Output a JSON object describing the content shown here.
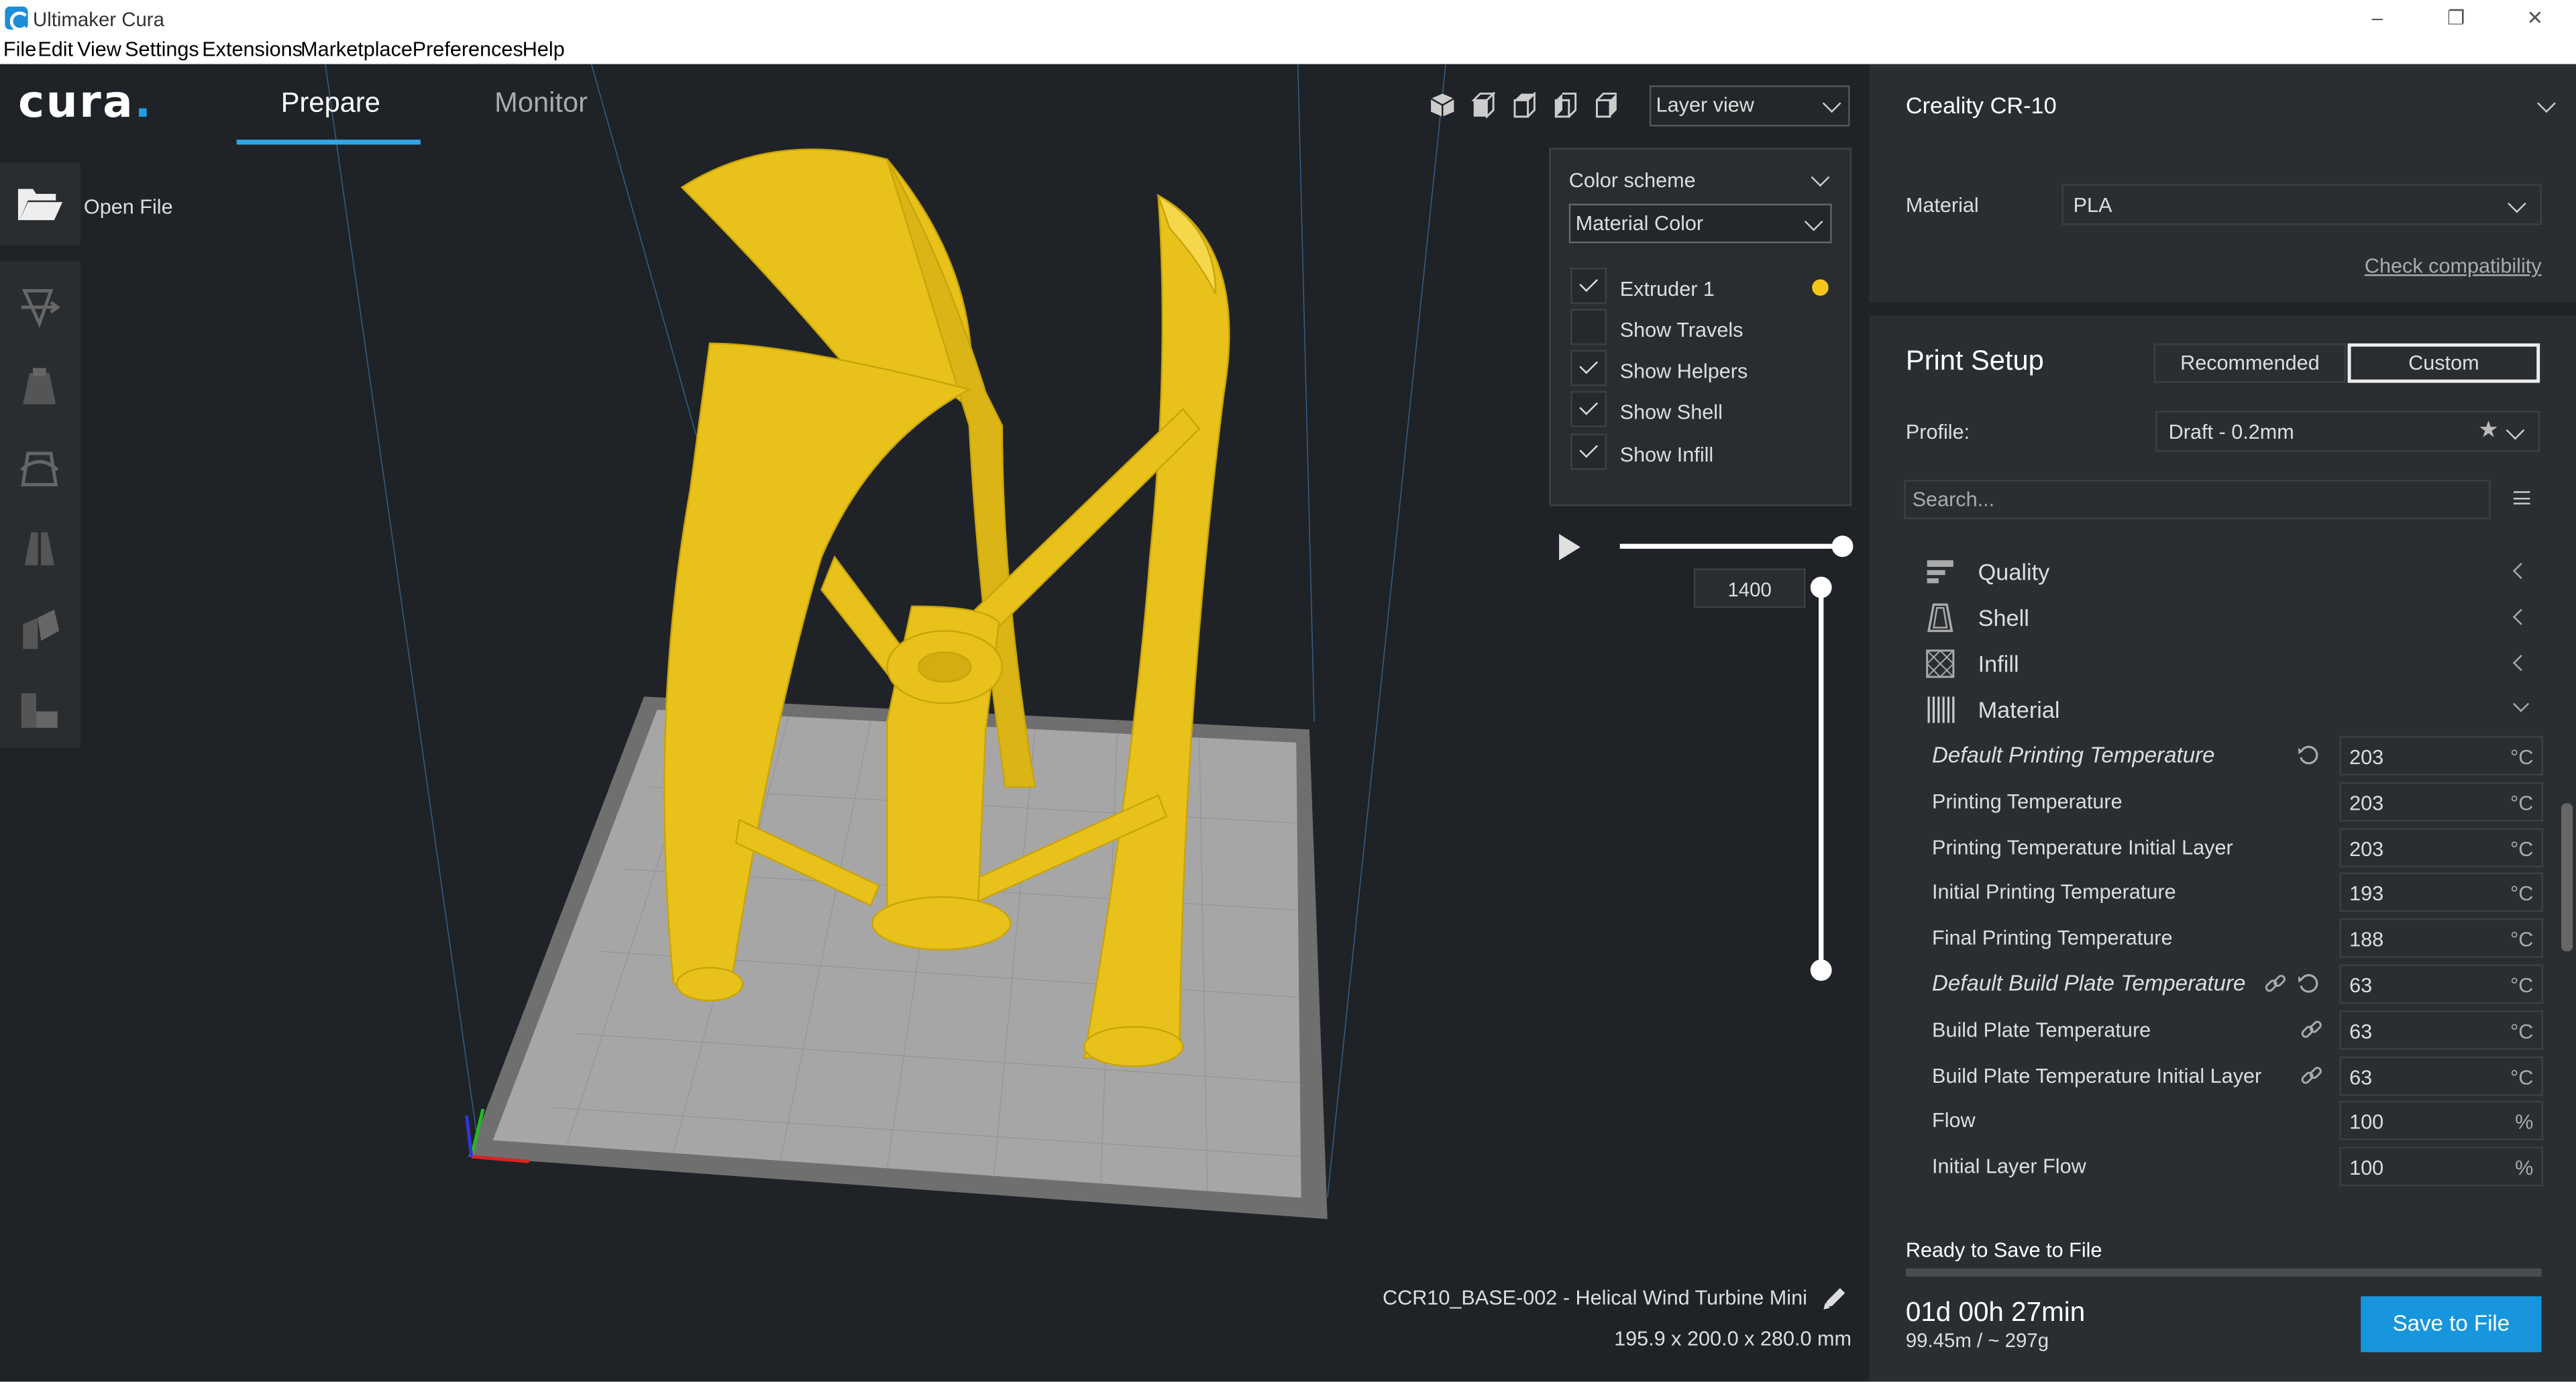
{
  "window": {
    "title": "Ultimaker Cura"
  },
  "menu": [
    "File",
    "Edit",
    "View",
    "Settings",
    "Extensions",
    "Marketplace",
    "Preferences",
    "Help"
  ],
  "header": {
    "logo": "cura",
    "tabs": [
      "Prepare",
      "Monitor"
    ],
    "active_tab": "Prepare",
    "view_mode": "Layer view"
  },
  "toolbar": {
    "open_file": "Open File"
  },
  "layer_panel": {
    "color_scheme_label": "Color scheme",
    "color_scheme_value": "Material Color",
    "options": [
      {
        "label": "Extruder 1",
        "checked": true
      },
      {
        "label": "Show Travels",
        "checked": false
      },
      {
        "label": "Show Helpers",
        "checked": true
      },
      {
        "label": "Show Shell",
        "checked": true
      },
      {
        "label": "Show Infill",
        "checked": true
      }
    ],
    "extruder_color": "#f5c71a",
    "current_layer": "1400"
  },
  "object": {
    "name": "CCR10_BASE-002 - Helical Wind Turbine Mini",
    "dimensions": "195.9 x 200.0 x 280.0 mm"
  },
  "printer": {
    "name": "Creality CR-10",
    "material_label": "Material",
    "material_value": "PLA",
    "check_compat": "Check compatibility"
  },
  "print_setup": {
    "title": "Print Setup",
    "modes": [
      "Recommended",
      "Custom"
    ],
    "active_mode": "Custom",
    "profile_label": "Profile:",
    "profile_value": "Draft - 0.2mm",
    "search_placeholder": "Search...",
    "categories": [
      {
        "label": "Quality",
        "icon": "quality-icon",
        "expanded": false
      },
      {
        "label": "Shell",
        "icon": "shell-icon",
        "expanded": false
      },
      {
        "label": "Infill",
        "icon": "infill-icon",
        "expanded": false
      },
      {
        "label": "Material",
        "icon": "material-icon",
        "expanded": true
      }
    ],
    "settings": [
      {
        "label": "Default Printing Temperature",
        "value": "203",
        "unit": "°C",
        "italic": true,
        "reset": true,
        "link": false
      },
      {
        "label": "Printing Temperature",
        "value": "203",
        "unit": "°C",
        "italic": false,
        "reset": false,
        "link": false
      },
      {
        "label": "Printing Temperature Initial Layer",
        "value": "203",
        "unit": "°C",
        "italic": false,
        "reset": false,
        "link": false
      },
      {
        "label": "Initial Printing Temperature",
        "value": "193",
        "unit": "°C",
        "italic": false,
        "reset": false,
        "link": false
      },
      {
        "label": "Final Printing Temperature",
        "value": "188",
        "unit": "°C",
        "italic": false,
        "reset": false,
        "link": false
      },
      {
        "label": "Default Build Plate Temperature",
        "value": "63",
        "unit": "°C",
        "italic": true,
        "reset": true,
        "link": true
      },
      {
        "label": "Build Plate Temperature",
        "value": "63",
        "unit": "°C",
        "italic": false,
        "reset": false,
        "link": true
      },
      {
        "label": "Build Plate Temperature Initial Layer",
        "value": "63",
        "unit": "°C",
        "italic": false,
        "reset": false,
        "link": true
      },
      {
        "label": "Flow",
        "value": "100",
        "unit": "%",
        "italic": false,
        "reset": false,
        "link": false
      },
      {
        "label": "Initial Layer Flow",
        "value": "100",
        "unit": "%",
        "italic": false,
        "reset": false,
        "link": false
      }
    ]
  },
  "output": {
    "status": "Ready to Save to File",
    "time": "01d 00h 27min",
    "stats": "99.45m / ~ 297g",
    "save_label": "Save to File"
  },
  "colors": {
    "accent": "#1796dd",
    "background": "#1f2327",
    "model": "#f5c71a"
  }
}
